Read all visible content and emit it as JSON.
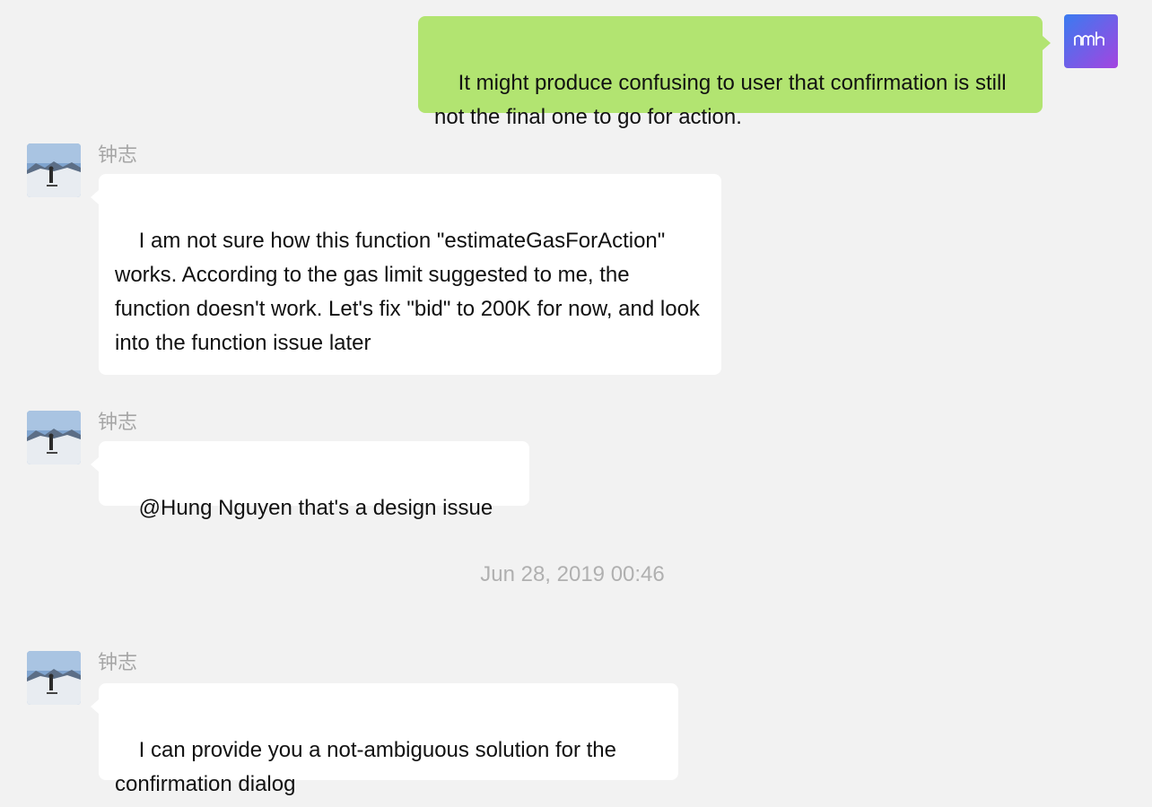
{
  "colors": {
    "background": "#f2f2f2",
    "outgoing_bubble": "#b2e471",
    "incoming_bubble": "#ffffff",
    "sender_name": "#a6a6a6",
    "timestamp": "#b0b0b0"
  },
  "messages": [
    {
      "direction": "outgoing",
      "avatar": "self-avatar-icon",
      "avatar_text": "nmh",
      "text": "It might produce confusing to user that confirmation is still not the final one to go for action."
    },
    {
      "direction": "incoming",
      "sender": "钟志",
      "avatar": "snowy-mountain-photo-avatar",
      "text": "I am not sure how this function \"estimateGasForAction\" works. According to the gas limit suggested to me, the function doesn't work. Let's fix \"bid\" to 200K for now, and look into the function issue later"
    },
    {
      "direction": "incoming",
      "sender": "钟志",
      "avatar": "snowy-mountain-photo-avatar",
      "text": "@Hung Nguyen that's a design issue"
    },
    {
      "direction": "incoming",
      "sender": "钟志",
      "avatar": "snowy-mountain-photo-avatar",
      "text": "I can provide you a not-ambiguous solution for the confirmation dialog"
    }
  ],
  "timestamp": "Jun 28, 2019 00:46"
}
